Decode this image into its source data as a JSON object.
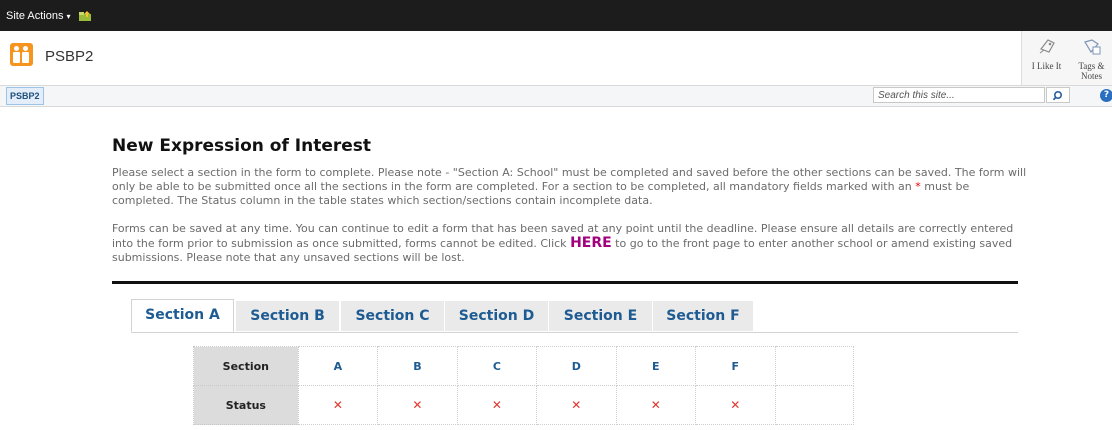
{
  "topbar": {
    "site_actions_label": "Site Actions",
    "caret": "▾"
  },
  "header": {
    "site_title": "PSBP2"
  },
  "right_panel": {
    "like_label": "I Like It",
    "tags_label": "Tags &",
    "tags_label2": "Notes"
  },
  "breadcrumb": {
    "current": "PSBP2"
  },
  "search": {
    "placeholder": "Search this site..."
  },
  "help": {
    "glyph": "?"
  },
  "page": {
    "heading": "New Expression of Interest",
    "p1_a": "Please select a section in the form to complete. Please note - \"Section A: School\" must be completed and saved before the other sections can be saved. The form will only be able to be submitted once all the sections in the form are completed. For a section to be completed, all mandatory fields marked with an ",
    "p1_star": "*",
    "p1_b": " must be completed. The Status column in the table states which section/sections contain incomplete data.",
    "p2_a": "Forms can be saved at any time. You can continue to edit a form that has been saved at any point until the deadline. Please ensure all details are correctly entered into the form prior to submission as once submitted, forms cannot be edited. Click ",
    "p2_here": "HERE",
    "p2_b": " to go to the front page to enter another school or amend existing saved submissions. Please note that any unsaved sections will be lost."
  },
  "tabs": [
    {
      "label": "Section A"
    },
    {
      "label": "Section B"
    },
    {
      "label": "Section C"
    },
    {
      "label": "Section D"
    },
    {
      "label": "Section E"
    },
    {
      "label": "Section F"
    }
  ],
  "status_table": {
    "row1_header": "Section",
    "row2_header": "Status",
    "sections": [
      "A",
      "B",
      "C",
      "D",
      "E",
      "F"
    ],
    "statuses": [
      "✕",
      "✕",
      "✕",
      "✕",
      "✕",
      "✕"
    ]
  },
  "colors": {
    "accent": "#1d5b92",
    "incomplete": "#e0372e",
    "logo": "#f79420",
    "here_link": "#a3007e"
  }
}
